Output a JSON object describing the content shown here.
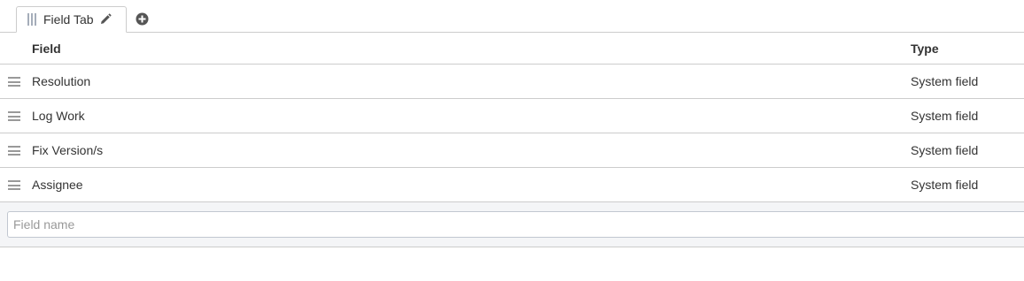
{
  "tabs": [
    {
      "label": "Field Tab"
    }
  ],
  "icons": {
    "tab_grip": "grip-icon",
    "tab_edit": "pencil-icon",
    "add_tab": "plus-circle-icon",
    "row_drag": "drag-handle-icon"
  },
  "table": {
    "headers": {
      "field": "Field",
      "type": "Type"
    },
    "rows": [
      {
        "field": "Resolution",
        "type": "System field"
      },
      {
        "field": "Log Work",
        "type": "System field"
      },
      {
        "field": "Fix Version/s",
        "type": "System field"
      },
      {
        "field": "Assignee",
        "type": "System field"
      }
    ]
  },
  "add_field": {
    "placeholder": "Field name",
    "value": ""
  },
  "colors": {
    "border": "#cccccc",
    "text": "#333333",
    "icon": "#999999",
    "add_row_bg": "#f4f5f7"
  }
}
